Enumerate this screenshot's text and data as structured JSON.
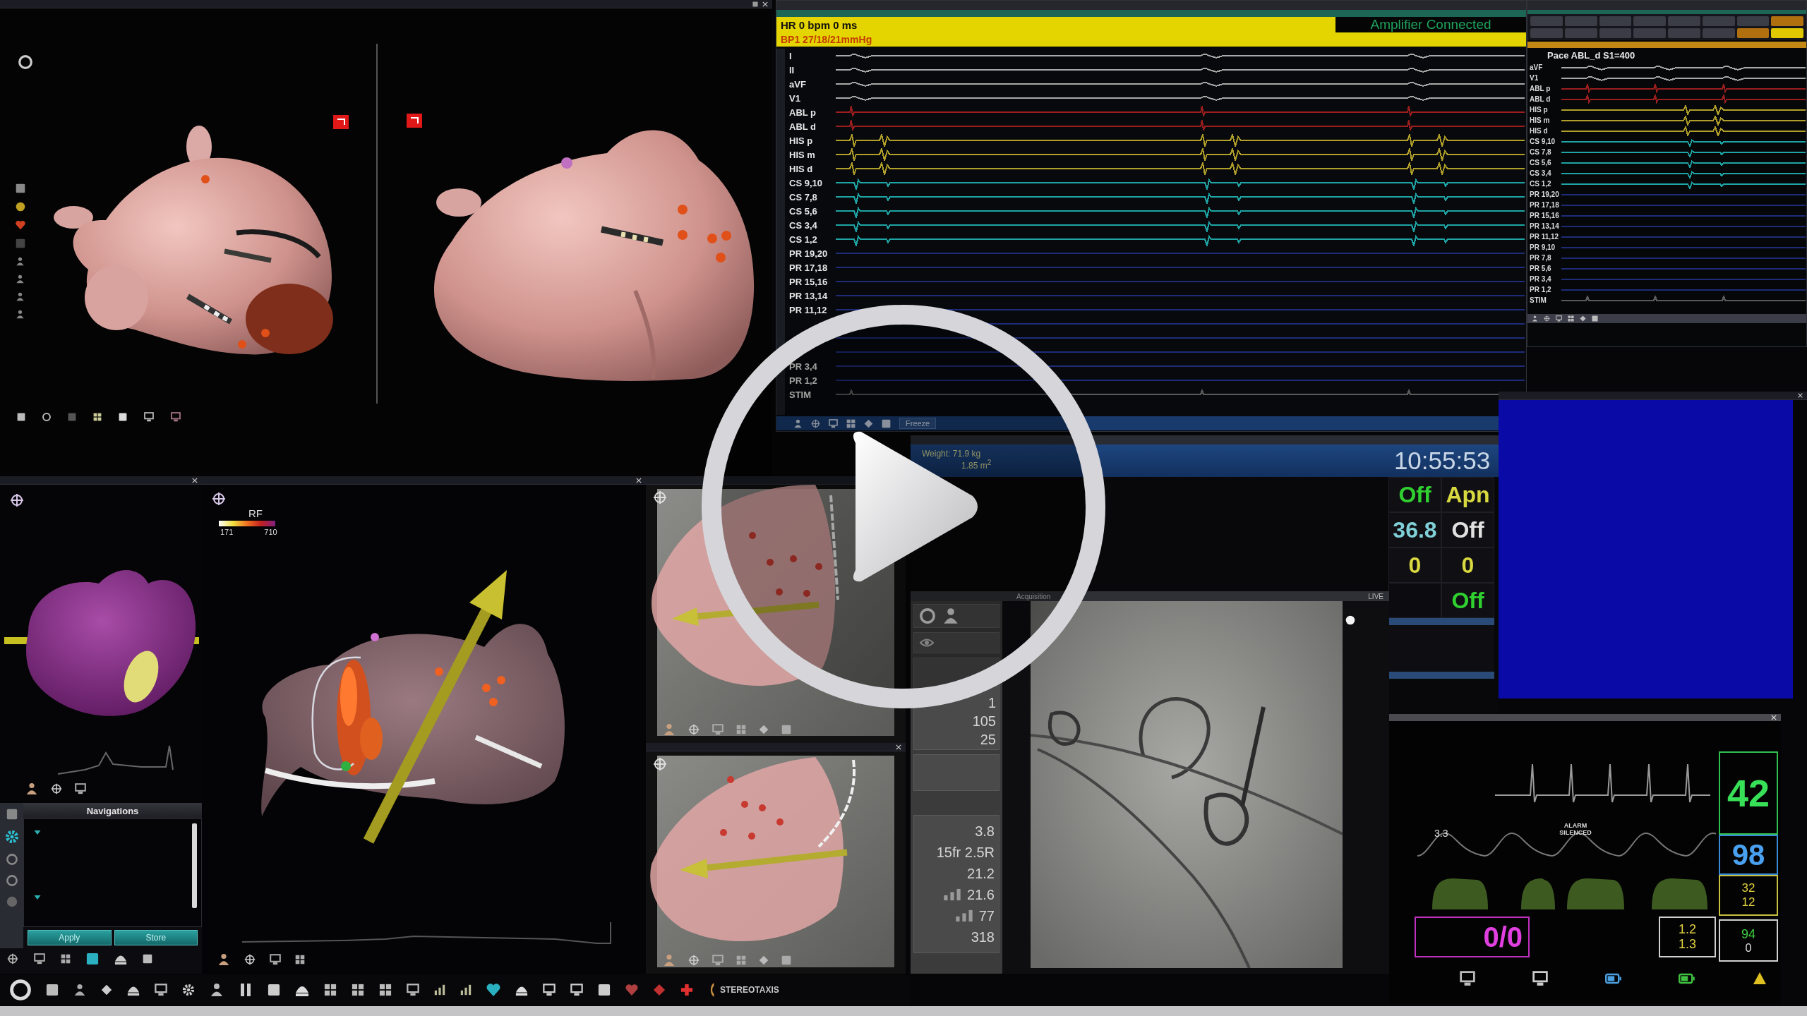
{
  "ecg_window": {
    "heart_rate": "HR 0 bpm 0 ms",
    "pressure": "BP1 27/18/21mmHg",
    "status": "Amplifier Connected",
    "channels": [
      {
        "label": "I",
        "kind": "surface",
        "color": "#a8a8a8"
      },
      {
        "label": "II",
        "kind": "surface",
        "color": "#a8a8a8"
      },
      {
        "label": "aVF",
        "kind": "surface",
        "color": "#a8a8a8"
      },
      {
        "label": "V1",
        "kind": "surface",
        "color": "#a8a8a8"
      },
      {
        "label": "ABL p",
        "kind": "ablation",
        "color": "#9a1e1e"
      },
      {
        "label": "ABL d",
        "kind": "ablation",
        "color": "#9a1e1e"
      },
      {
        "label": "HIS p",
        "kind": "his",
        "color": "#b0a02a"
      },
      {
        "label": "HIS m",
        "kind": "his",
        "color": "#b0a02a"
      },
      {
        "label": "HIS d",
        "kind": "his",
        "color": "#b0a02a"
      },
      {
        "label": "CS 9,10",
        "kind": "cs",
        "color": "#1ea4a4"
      },
      {
        "label": "CS 7,8",
        "kind": "cs",
        "color": "#1ea4a4"
      },
      {
        "label": "CS 5,6",
        "kind": "cs",
        "color": "#1ea4a4"
      },
      {
        "label": "CS 3,4",
        "kind": "cs",
        "color": "#1ea4a4"
      },
      {
        "label": "CS 1,2",
        "kind": "cs",
        "color": "#1ea4a4"
      },
      {
        "label": "PR 19,20",
        "kind": "pr",
        "color": "#1e2c78"
      },
      {
        "label": "PR 17,18",
        "kind": "pr",
        "color": "#1e2c78"
      },
      {
        "label": "PR 15,16",
        "kind": "pr",
        "color": "#1e2c78"
      },
      {
        "label": "PR 13,14",
        "kind": "pr",
        "color": "#1e2c78"
      },
      {
        "label": "PR 11,12",
        "kind": "pr",
        "color": "#1e2c78"
      },
      {
        "kind": "pr",
        "color": "#1e2c78"
      },
      {
        "kind": "pr",
        "color": "#1e2c78"
      },
      {
        "kind": "pr",
        "color": "#1e2c78"
      },
      {
        "label": "PR 3,4",
        "kind": "pr",
        "color": "#1e2c78"
      },
      {
        "label": "PR 1,2",
        "kind": "pr",
        "color": "#1e2c78"
      },
      {
        "label": "STIM",
        "kind": "stim",
        "color": "#5a5a5a"
      }
    ],
    "toolbar_button": "Freeze"
  },
  "pace_window": {
    "annotation": "Pace ABL_d S1=400",
    "channels": [
      {
        "label": "aVF",
        "kind": "surface",
        "color": "#a8a8a8"
      },
      {
        "label": "V1",
        "kind": "surface",
        "color": "#a8a8a8"
      },
      {
        "label": "ABL p",
        "kind": "ablation",
        "color": "#9a1e1e"
      },
      {
        "label": "ABL d",
        "kind": "ablation",
        "color": "#9a1e1e"
      },
      {
        "label": "HIS p",
        "kind": "his",
        "color": "#b0a02a"
      },
      {
        "label": "HIS m",
        "kind": "his",
        "color": "#b0a02a"
      },
      {
        "label": "HIS d",
        "kind": "his",
        "color": "#b0a02a"
      },
      {
        "label": "CS 9,10",
        "kind": "cs",
        "color": "#1ea4a4"
      },
      {
        "label": "CS 7,8",
        "kind": "cs",
        "color": "#1ea4a4"
      },
      {
        "label": "CS 5,6",
        "kind": "cs",
        "color": "#1ea4a4"
      },
      {
        "label": "CS 3,4",
        "kind": "cs",
        "color": "#1ea4a4"
      },
      {
        "label": "CS 1,2",
        "kind": "cs",
        "color": "#1ea4a4"
      },
      {
        "label": "PR 19,20",
        "kind": "pr",
        "color": "#1e2c78"
      },
      {
        "label": "PR 17,18",
        "kind": "pr",
        "color": "#1e2c78"
      },
      {
        "label": "PR 15,16",
        "kind": "pr",
        "color": "#1e2c78"
      },
      {
        "label": "PR 13,14",
        "kind": "pr",
        "color": "#1e2c78"
      },
      {
        "label": "PR 11,12",
        "kind": "pr",
        "color": "#1e2c78"
      },
      {
        "label": "PR 9,10",
        "kind": "pr",
        "color": "#1e2c78"
      },
      {
        "label": "PR 7,8",
        "kind": "pr",
        "color": "#1e2c78"
      },
      {
        "label": "PR 5,6",
        "kind": "pr",
        "color": "#1e2c78"
      },
      {
        "label": "PR 3,4",
        "kind": "pr",
        "color": "#1e2c78"
      },
      {
        "label": "PR 1,2",
        "kind": "pr",
        "color": "#1e2c78"
      },
      {
        "label": "STIM",
        "kind": "stim",
        "color": "#5a5a5a"
      }
    ]
  },
  "navigation_panel": {
    "title": "Navigations",
    "buttons": [
      "Apply",
      "Store"
    ]
  },
  "map_view": {
    "scale_label": "RF",
    "scale_min": "171",
    "scale_max": "710"
  },
  "vitals_window": {
    "weight": "Weight: 71.9 kg",
    "body_surface": "1.85 m$^{2}$",
    "time": "10:55:53",
    "rows": [
      {
        "left": {
          "value": "Off",
          "color": "#30d030"
        },
        "right": {
          "value": "Apn",
          "color": "#d8d840"
        }
      },
      {
        "left": {
          "value": "36.8",
          "color": "#80d0d8"
        },
        "right": {
          "value": "Off",
          "color": "#e0e0e0"
        }
      },
      {
        "left": {
          "value": "0",
          "color": "#d8d840"
        },
        "right": {
          "value": "0",
          "color": "#d8d840"
        }
      },
      {
        "right": {
          "value": "Off",
          "color": "#30d030"
        }
      }
    ]
  },
  "fluoro_window": {
    "title": "Acquisition",
    "live_label": "LIVE",
    "counters": [
      "1",
      "105",
      "25"
    ],
    "parameters": [
      "3.8",
      "15fr 2.5R",
      "21.2",
      "21.6",
      "77",
      "318"
    ]
  },
  "patient_monitor": {
    "heart_rate": "42",
    "spo2": "98",
    "pleth_scale": "3.3",
    "alarm": "ALARM SILENCED",
    "nibp": "0/0",
    "temperatures": [
      "32",
      "12"
    ],
    "co2": [
      "1.2",
      "1.3"
    ],
    "gas": [
      "94",
      "0"
    ]
  },
  "taskbar": {
    "logo": "STEREOTAXIS"
  },
  "player": {
    "paused": true
  }
}
